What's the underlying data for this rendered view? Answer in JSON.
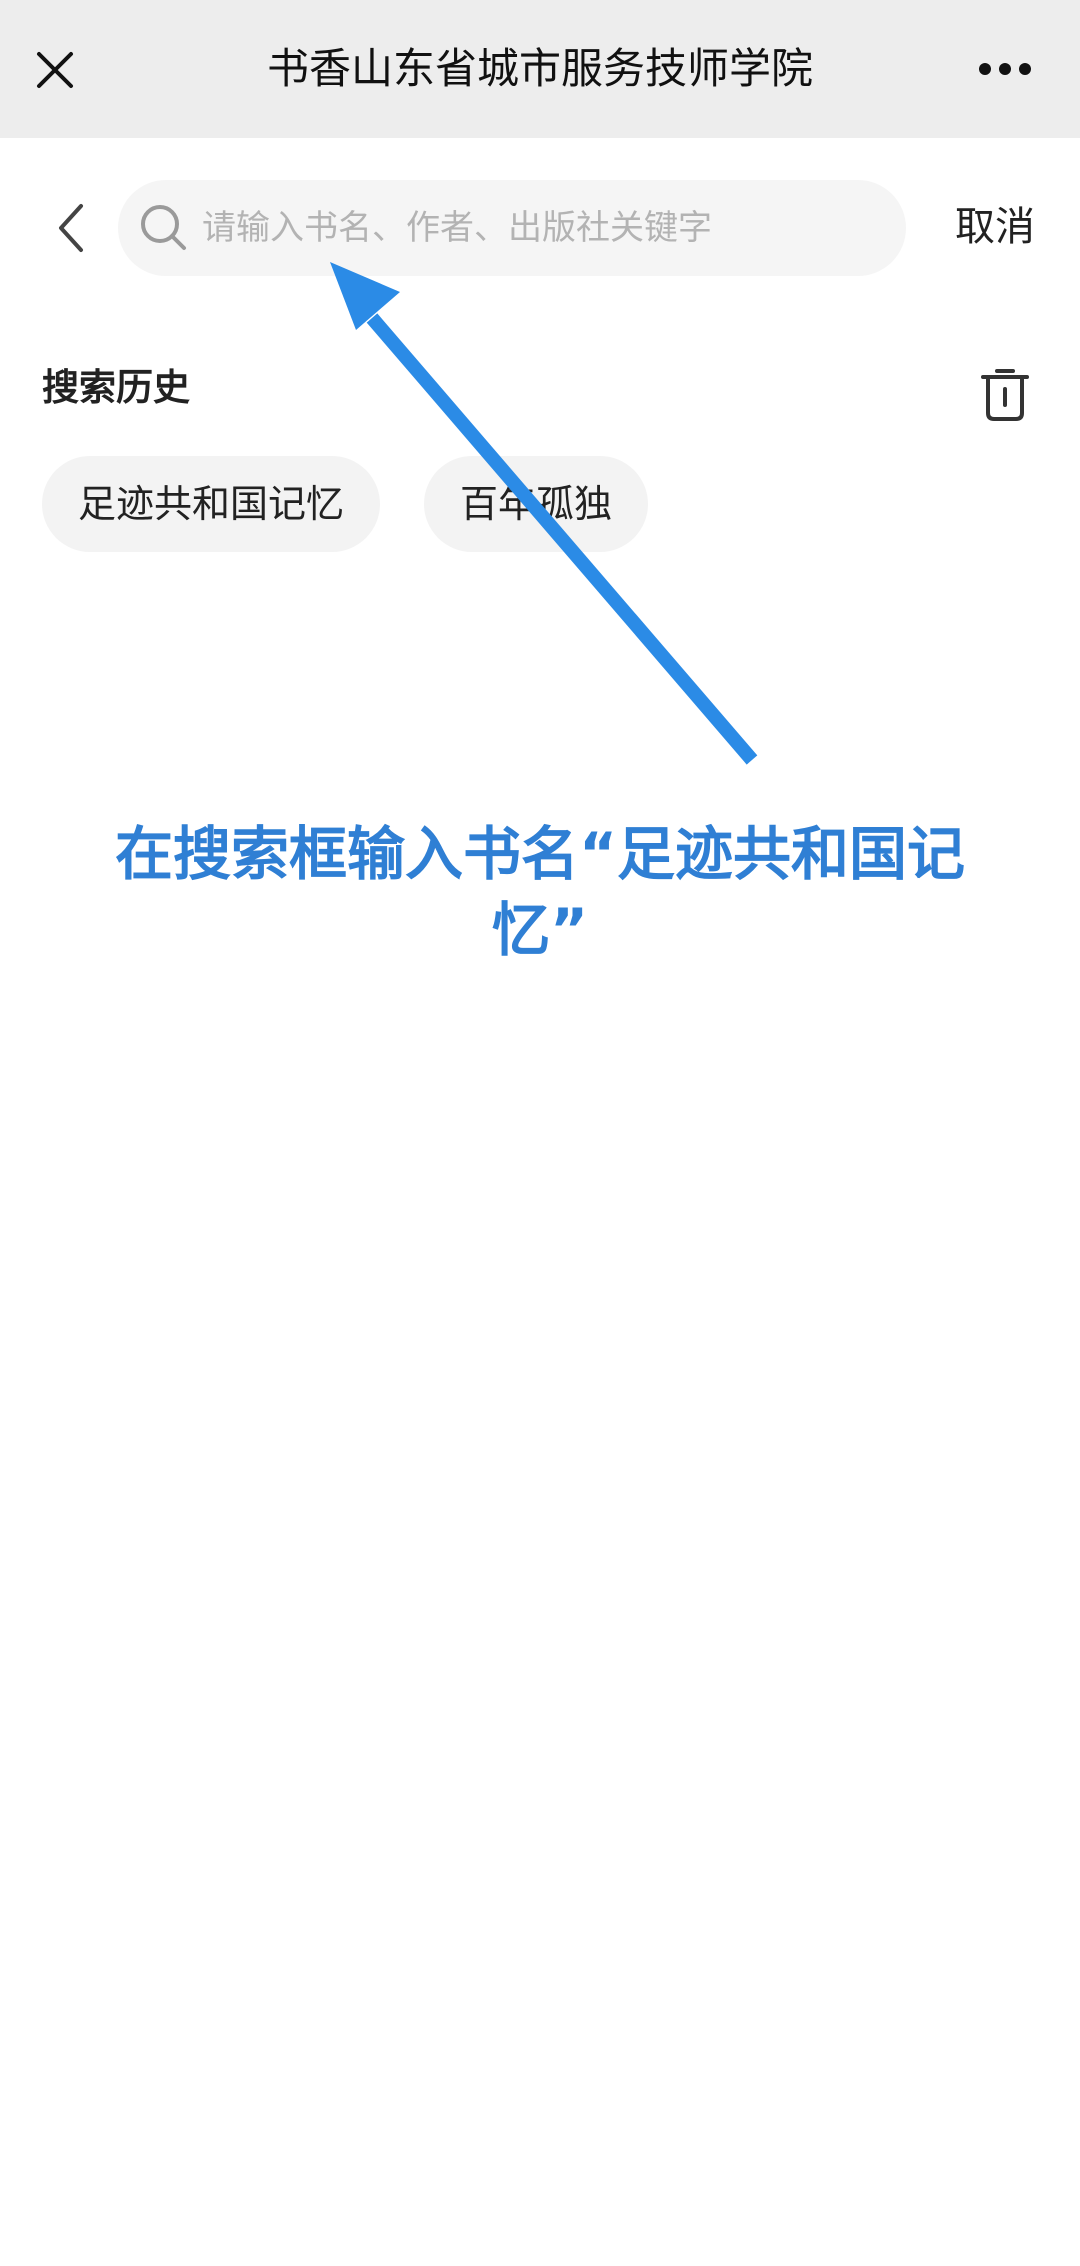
{
  "titlebar": {
    "title": "书香山东省城市服务技师学院",
    "close_icon": "close-icon",
    "more_icon": "more-icon"
  },
  "search": {
    "placeholder": "请输入书名、作者、出版社关键字",
    "value": "",
    "cancel_label": "取消",
    "back_icon": "chevron-left-icon",
    "search_icon": "search-icon"
  },
  "history": {
    "title": "搜索历史",
    "clear_icon": "trash-icon",
    "items": [
      {
        "label": "足迹共和国记忆"
      },
      {
        "label": "百年孤独"
      }
    ]
  },
  "annotation": {
    "text": "在搜索框输入书名“足迹共和国记忆”",
    "color": "#2f7fd4",
    "arrow_color": "#2b8be6"
  }
}
